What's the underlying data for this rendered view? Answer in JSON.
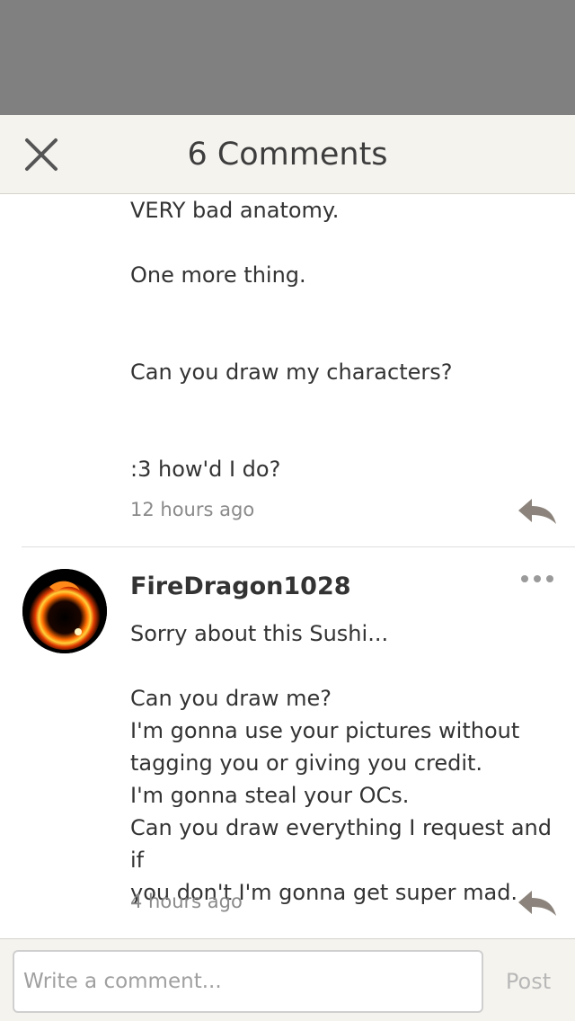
{
  "header": {
    "title": "6 Comments",
    "close_icon": "close-icon"
  },
  "comments": [
    {
      "body": "VERY bad anatomy.\n\nOne more thing.\n\n\nCan you draw my characters?\n\n\n:3 how'd I do?",
      "time": "12 hours ago",
      "reply_icon": "reply-arrow-icon"
    },
    {
      "author": "FireDragon1028",
      "avatar_icon": "fire-dragon-avatar",
      "more_icon": "more-dots-icon",
      "body": "Sorry about this Sushi...\n\nCan you draw me?\nI'm gonna use your pictures without\ntagging you or giving you credit.\nI'm gonna steal your OCs.\nCan you draw everything I request and if\nyou don't I'm gonna get super mad.",
      "time": "4 hours ago",
      "reply_icon": "reply-arrow-icon"
    }
  ],
  "composer": {
    "placeholder": "Write a comment...",
    "post_label": "Post"
  },
  "colors": {
    "header_bg": "#f5f3ee",
    "overlay": "#808080",
    "icon_gray": "#8c847c",
    "post_disabled": "#b8b8b8"
  }
}
